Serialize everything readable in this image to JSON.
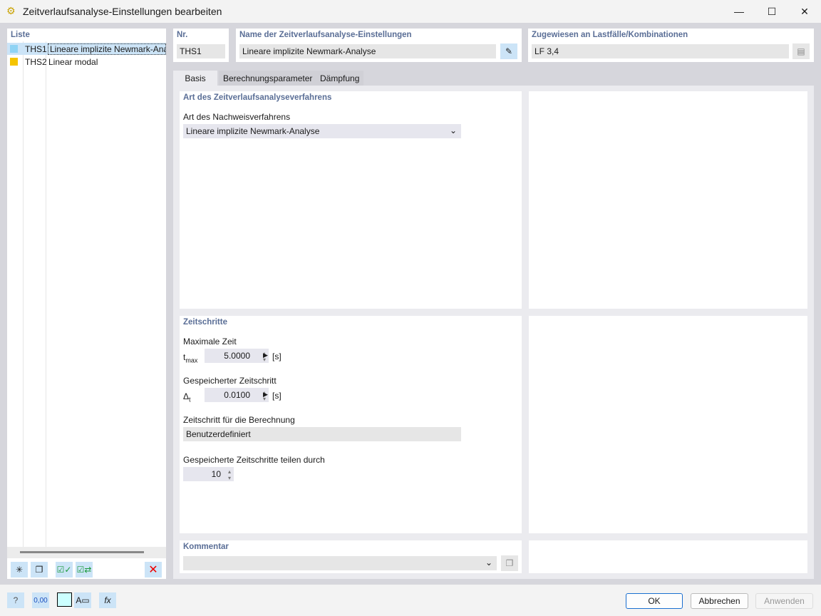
{
  "window": {
    "title": "Zeitverlaufsanalyse-Einstellungen bearbeiten",
    "minimize": "—",
    "maximize": "☐",
    "close": "✕"
  },
  "list": {
    "header": "Liste",
    "items": [
      {
        "id": "THS1",
        "name": "Lineare implizite Newmark-Analyse",
        "color": "#8fd3f4",
        "selected": true
      },
      {
        "id": "THS2",
        "name": "Linear modal",
        "color": "#f5c400",
        "selected": false
      }
    ]
  },
  "header": {
    "nr_label": "Nr.",
    "nr_value": "THS1",
    "name_label": "Name der Zeitverlaufsanalyse-Einstellungen",
    "name_value": "Lineare implizite Newmark-Analyse",
    "assigned_label": "Zugewiesen an Lastfälle/Kombinationen",
    "assigned_value": "LF 3,4"
  },
  "tabs": [
    {
      "label": "Basis",
      "active": true
    },
    {
      "label": "Berechnungsparameter"
    },
    {
      "label": "Dämpfung"
    }
  ],
  "method": {
    "section": "Art des Zeitverlaufsanalyseverfahrens",
    "label": "Art des Nachweisverfahrens",
    "value": "Lineare implizite Newmark-Analyse"
  },
  "timesteps": {
    "section": "Zeitschritte",
    "max_label": "Maximale Zeit",
    "tmax_sym": "t",
    "tmax_sub": "max",
    "tmax_value": "5.0000",
    "unit": "[s]",
    "saved_label": "Gespeicherter Zeitschritt",
    "dt_sym": "Δ",
    "dt_sub": "t",
    "dt_value": "0.0100",
    "calc_label": "Zeitschritt für die Berechnung",
    "calc_value": "Benutzerdefiniert",
    "divide_label": "Gespeicherte Zeitschritte teilen durch",
    "divide_value": "10"
  },
  "comment": {
    "label": "Kommentar",
    "value": ""
  },
  "buttons": {
    "ok": "OK",
    "cancel": "Abbrechen",
    "apply": "Anwenden"
  }
}
